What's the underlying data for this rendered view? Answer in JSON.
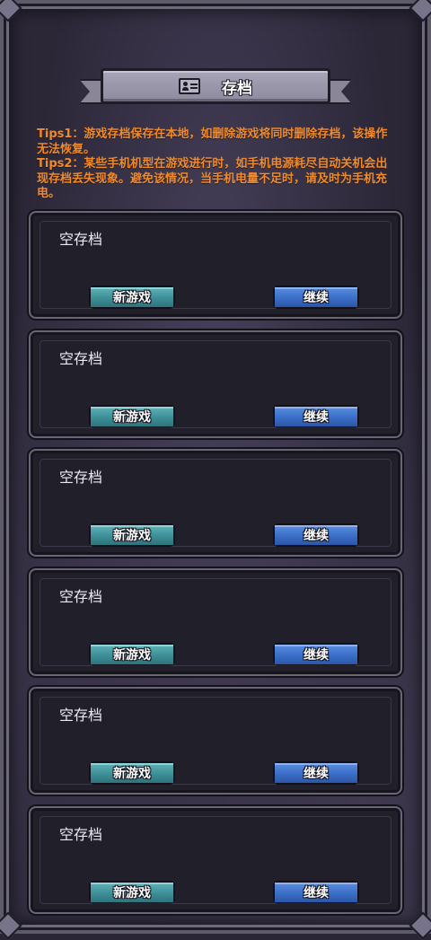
{
  "header": {
    "title": "存档",
    "icon": "id-card-icon"
  },
  "tips": {
    "tip1": "Tips1：游戏存档保存在本地，如删除游戏将同时删除存档，该操作无法恢复。",
    "tip2": "Tips2：某些手机机型在游戏进行时，如手机电源耗尽自动关机会出现存档丢失现象。避免该情况，当手机电量不足时，请及时为手机充电。"
  },
  "colors": {
    "tips": "#f08a2a",
    "new_game_button": "#3d8f97",
    "continue_button": "#3a6ec8"
  },
  "slots": [
    {
      "label": "空存档",
      "new_game": "新游戏",
      "continue": "继续"
    },
    {
      "label": "空存档",
      "new_game": "新游戏",
      "continue": "继续"
    },
    {
      "label": "空存档",
      "new_game": "新游戏",
      "continue": "继续"
    },
    {
      "label": "空存档",
      "new_game": "新游戏",
      "continue": "继续"
    },
    {
      "label": "空存档",
      "new_game": "新游戏",
      "continue": "继续"
    },
    {
      "label": "空存档",
      "new_game": "新游戏",
      "continue": "继续"
    }
  ]
}
